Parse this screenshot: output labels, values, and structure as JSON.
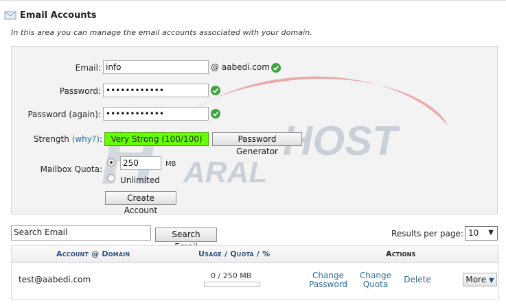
{
  "header": {
    "title": "Email Accounts",
    "intro": "In this area you can manage the email accounts associated with your domain."
  },
  "form": {
    "email_label": "Email:",
    "email_value": "info",
    "domain_suffix": "@ aabedi.com",
    "password_label": "Password:",
    "password_value": "••••••••••••",
    "password_again_label": "Password (again):",
    "password_again_value": "••••••••••••",
    "strength_label": "Strength",
    "strength_why": "(why?)",
    "strength_colon": ":",
    "strength_value": "Very Strong (100/100)",
    "password_generator_button": "Password Generator",
    "quota_label": "Mailbox Quota:",
    "quota_value": "250",
    "quota_unit": "MB",
    "unlimited_label": "Unlimited",
    "create_button": "Create Account"
  },
  "watermark": {
    "word1": "ARAL",
    "word2": "HOST"
  },
  "search": {
    "value": "Search Email",
    "button": "Search Email"
  },
  "pagination": {
    "results_label": "Results per page:",
    "results_value": "10"
  },
  "table": {
    "col_account": "Account",
    "col_at": "@",
    "col_domain": "Domain",
    "col_usage": "Usage",
    "col_slash1": "/",
    "col_quota": "Quota",
    "col_slash2": "/",
    "col_pct": "%",
    "col_actions": "Actions",
    "rows": [
      {
        "account": "test@aabedi.com",
        "usage": "0 / 250 MB",
        "usage_fraction": 0,
        "change_password_1": "Change",
        "change_password_2": "Password",
        "change_quota_1": "Change",
        "change_quota_2": "Quota",
        "delete": "Delete",
        "more": "More"
      }
    ]
  },
  "colors": {
    "strength_green": "#66ff00",
    "link_blue": "#2c6a9e",
    "check_green": "#3aa63a",
    "watermark_red": "#e05050"
  }
}
